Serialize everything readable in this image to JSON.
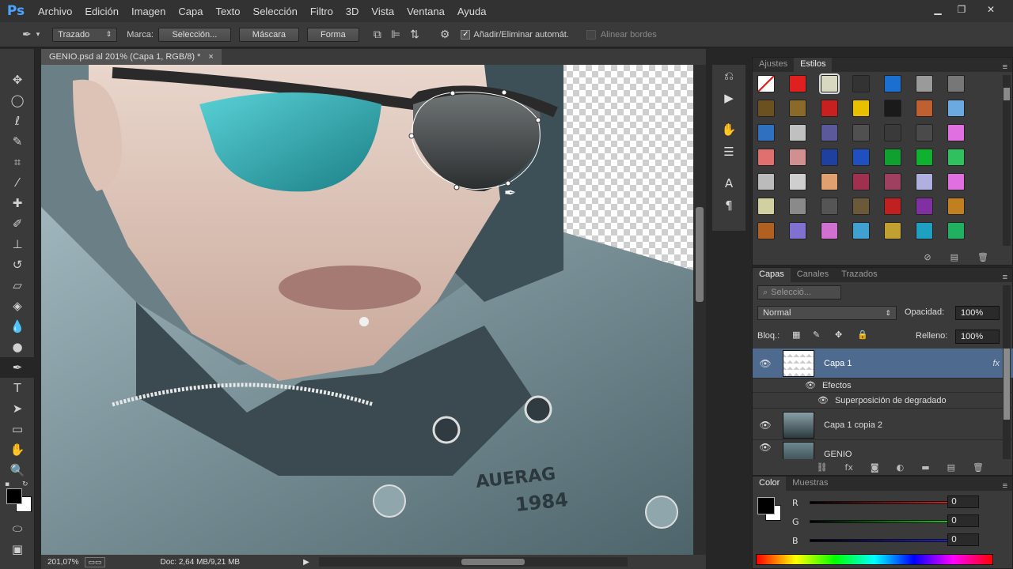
{
  "app": {
    "logo": "Ps"
  },
  "menu": [
    "Archivo",
    "Edición",
    "Imagen",
    "Capa",
    "Texto",
    "Selección",
    "Filtro",
    "3D",
    "Vista",
    "Ventana",
    "Ayuda"
  ],
  "window": {
    "minimize": "▁",
    "restore": "❐",
    "close": "✕"
  },
  "options": {
    "mode_value": "Trazado",
    "marca_label": "Marca:",
    "seleccion_btn": "Selección...",
    "mascara_btn": "Máscara",
    "forma_btn": "Forma",
    "auto_add_label": "Añadir/Eliminar automát.",
    "align_edges_label": "Alinear bordes"
  },
  "document": {
    "tab_title": "GENIO.psd al 201% (Capa 1, RGB/8) *",
    "close": "×"
  },
  "canvas": {
    "jacket_text1": "AUERAG",
    "jacket_text2": "1984"
  },
  "status": {
    "zoom": "201,07%",
    "doc": "Doc: 2,64 MB/9,21 MB"
  },
  "styles_panel": {
    "tabs": [
      "Ajustes",
      "Estilos"
    ],
    "active_tab": "Estilos",
    "swatches": [
      "#ffffff",
      "#e02020",
      "#d8d8c0",
      "#333333",
      "#1a6fd0",
      "#9a9a9a",
      "#777777",
      "#6b5020",
      "#8a6a2a",
      "#c82020",
      "#e8c000",
      "#1a1a1a",
      "#c06030",
      "#6aaae0",
      "#3070c0",
      "#c0c0c0",
      "#5a5a9a",
      "#505050",
      "#3a3a3a",
      "#4a4a4a",
      "#e070e0",
      "#e07070",
      "#d09090",
      "#2040a0",
      "#2050c0",
      "#10a030",
      "#10b030",
      "#30c060",
      "#bbbbbb",
      "#cfcfcf",
      "#e0a070",
      "#a03050",
      "#a04060",
      "#b0b0e0",
      "#e070e0",
      "#d0d0a0",
      "#8a8a8a",
      "#555555",
      "#6a5a3a",
      "#c02020",
      "#8030a0",
      "#c08020",
      "#b06020",
      "#8070d0",
      "#d070d0",
      "#40a0d0",
      "#c0a030",
      "#20a0c0",
      "#20b060"
    ]
  },
  "layers_panel": {
    "tabs": [
      "Capas",
      "Canales",
      "Trazados"
    ],
    "active_tab": "Capas",
    "filter_placeholder": "Selecció...",
    "blend_mode": "Normal",
    "opacity_label": "Opacidad:",
    "opacity_value": "100%",
    "lock_label": "Bloq.:",
    "fill_label": "Relleno:",
    "fill_value": "100%",
    "layers": [
      {
        "name": "Capa 1",
        "fx": "fx",
        "selected": true
      },
      {
        "name": "Capa 1 copia 2"
      },
      {
        "name": "GENIO"
      }
    ],
    "effects_label": "Efectos",
    "effect_item": "Superposición de degradado"
  },
  "color_panel": {
    "tabs": [
      "Color",
      "Muestras"
    ],
    "active_tab": "Color",
    "channels": [
      {
        "label": "R",
        "value": "0",
        "color": "#d02020"
      },
      {
        "label": "G",
        "value": "0",
        "color": "#20c020"
      },
      {
        "label": "B",
        "value": "0",
        "color": "#2020d0"
      }
    ]
  }
}
